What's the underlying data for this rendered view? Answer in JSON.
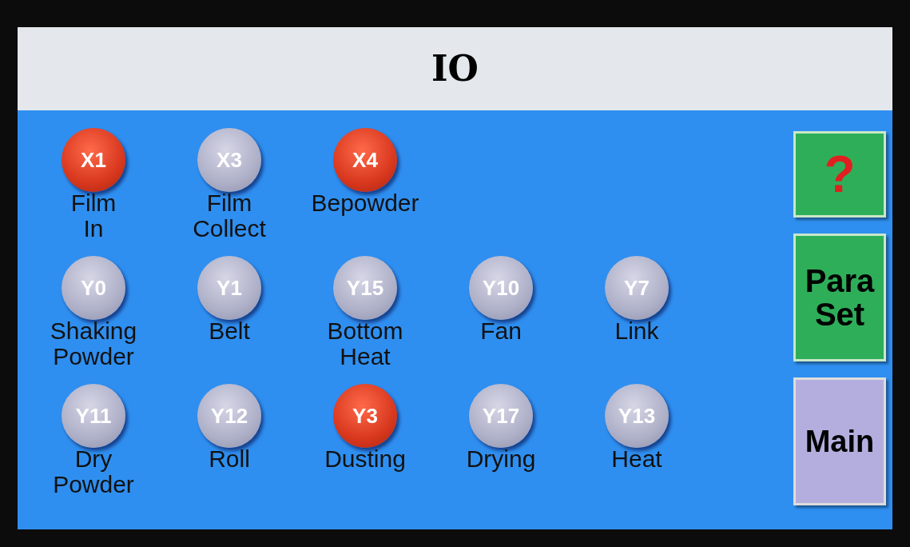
{
  "title": "IO",
  "rows": [
    [
      {
        "code": "X1",
        "on": true,
        "label_lines": [
          "Film",
          "In"
        ]
      },
      {
        "code": "X3",
        "on": false,
        "label_lines": [
          "Film",
          "Collect"
        ]
      },
      {
        "code": "X4",
        "on": true,
        "label_lines": [
          "Bepowder"
        ]
      }
    ],
    [
      {
        "code": "Y0",
        "on": false,
        "label_lines": [
          "Shaking",
          "Powder"
        ]
      },
      {
        "code": "Y1",
        "on": false,
        "label_lines": [
          "Belt"
        ]
      },
      {
        "code": "Y15",
        "on": false,
        "label_lines": [
          "Bottom",
          "Heat"
        ]
      },
      {
        "code": "Y10",
        "on": false,
        "label_lines": [
          "Fan"
        ]
      },
      {
        "code": "Y7",
        "on": false,
        "label_lines": [
          "Link"
        ]
      }
    ],
    [
      {
        "code": "Y11",
        "on": false,
        "label_lines": [
          "Dry",
          "Powder"
        ]
      },
      {
        "code": "Y12",
        "on": false,
        "label_lines": [
          "Roll"
        ]
      },
      {
        "code": "Y3",
        "on": true,
        "label_lines": [
          "Dusting"
        ]
      },
      {
        "code": "Y17",
        "on": false,
        "label_lines": [
          "Drying"
        ]
      },
      {
        "code": "Y13",
        "on": false,
        "label_lines": [
          "Heat"
        ]
      }
    ]
  ],
  "side_buttons": [
    {
      "kind": "help",
      "label": "?"
    },
    {
      "kind": "nav",
      "label_lines": [
        "Para",
        "Set"
      ]
    },
    {
      "kind": "home",
      "label_lines": [
        "Main"
      ]
    }
  ]
}
